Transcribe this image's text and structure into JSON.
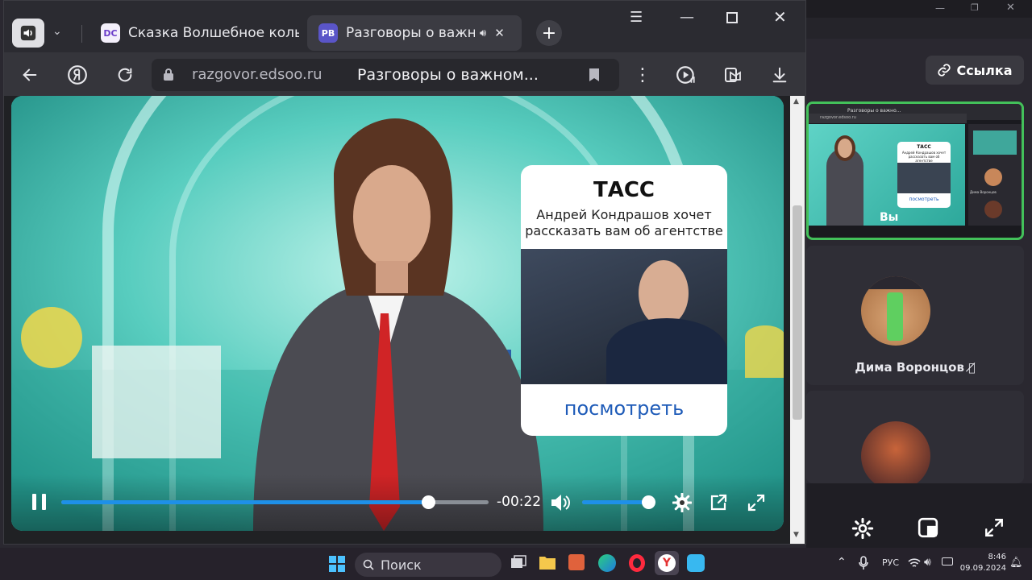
{
  "browser": {
    "tabs": [
      {
        "label": "Сказка Волшебное кольцо",
        "favicon": "DC"
      },
      {
        "label": "Разговоры о важном",
        "favicon": "РВ"
      }
    ],
    "url": "razgovor.edsoo.ru",
    "page_title": "Разговоры о важном..."
  },
  "video": {
    "card": {
      "brand": "ТАСС",
      "line1": "Андрей Кондрашов хочет",
      "line2": "рассказать вам об агентстве",
      "cta": "посмотреть"
    },
    "time_remaining": "-00:22",
    "progress": 0.86,
    "volume": 1.0
  },
  "conference": {
    "link_label": "Ссылка",
    "self_label": "Вы",
    "participant_name": "Дима Воронцов",
    "mini": {
      "url": "razgovor.edsoo.ru",
      "tab": "Разговоры о важно...",
      "card_brand": "ТАСС",
      "card_text": "Андрей Кондрашов хочет рассказать вам об агентстве",
      "card_cta": "посмотреть",
      "participant": "Дима Воронцов",
      "link": "Ссылка"
    }
  },
  "taskbar": {
    "search_label": "Поиск",
    "lang": "РУС",
    "time": "8:46",
    "date": "09.09.2024"
  },
  "colors": {
    "accent_blue": "#1e90e8",
    "active_green": "#43c15a",
    "cta_blue": "#1e5bb8"
  }
}
